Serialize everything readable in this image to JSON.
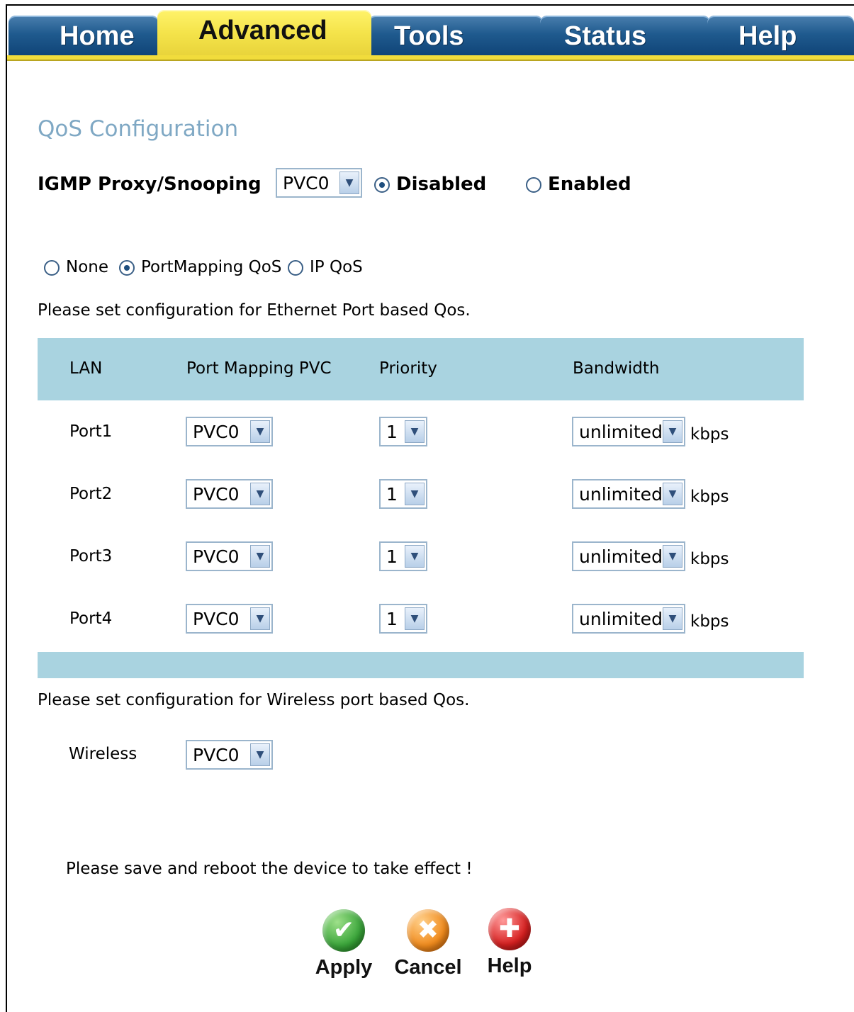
{
  "tabs": [
    {
      "label": "Home",
      "active": false
    },
    {
      "label": "Advanced",
      "active": true
    },
    {
      "label": "Tools",
      "active": false
    },
    {
      "label": "Status",
      "active": false
    },
    {
      "label": "Help",
      "active": false
    }
  ],
  "page_title": "QoS Configuration",
  "igmp": {
    "label": "IGMP Proxy/Snooping",
    "pvc_selected": "PVC0",
    "disabled_label": "Disabled",
    "enabled_label": "Enabled",
    "selected": "Disabled"
  },
  "qos_mode": {
    "options": [
      "None",
      "PortMapping QoS",
      "IP QoS"
    ],
    "selected": "PortMapping QoS"
  },
  "ethernet_note": "Please set configuration for Ethernet Port based Qos.",
  "table": {
    "headers": [
      "LAN",
      "Port Mapping PVC",
      "Priority",
      "Bandwidth"
    ],
    "rows": [
      {
        "port": "Port1",
        "pvc": "PVC0",
        "priority": "1",
        "bandwidth": "unlimited",
        "unit": "kbps"
      },
      {
        "port": "Port2",
        "pvc": "PVC0",
        "priority": "1",
        "bandwidth": "unlimited",
        "unit": "kbps"
      },
      {
        "port": "Port3",
        "pvc": "PVC0",
        "priority": "1",
        "bandwidth": "unlimited",
        "unit": "kbps"
      },
      {
        "port": "Port4",
        "pvc": "PVC0",
        "priority": "1",
        "bandwidth": "unlimited",
        "unit": "kbps"
      }
    ]
  },
  "wireless_note": "Please set configuration for Wireless port based Qos.",
  "wireless": {
    "label": "Wireless",
    "pvc": "PVC0"
  },
  "save_note": "Please save and reboot the device to take effect !",
  "buttons": {
    "apply": "Apply",
    "cancel": "Cancel",
    "help": "Help"
  },
  "colors": {
    "tab_blue": "#1f5a8e",
    "tab_active": "#f4e34a",
    "band": "#a9d3e0",
    "title": "#7fa8c4",
    "apply": "#3aa53a",
    "cancel": "#f08a1c",
    "help": "#d62020"
  }
}
